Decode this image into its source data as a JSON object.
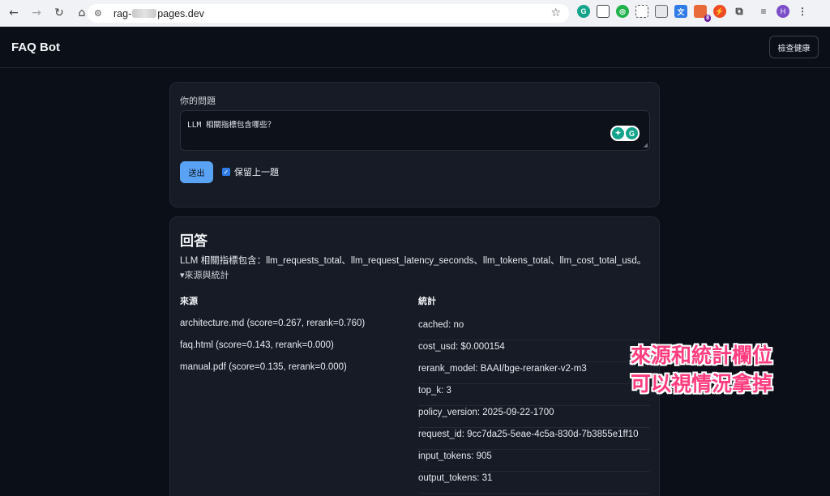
{
  "browser": {
    "url_prefix": "rag-",
    "url_suffix": "pages.dev",
    "profile_initial": "H",
    "extension_badge": "8"
  },
  "app": {
    "brand": "FAQ Bot",
    "health_button": "檢查健康"
  },
  "question": {
    "label": "你的問題",
    "value": "LLM 相關指標包含哪些？",
    "send_label": "送出",
    "keep_label": "保留上一題"
  },
  "answer": {
    "title": "回答",
    "text": "LLM 相關指標包含：llm_requests_total、llm_request_latency_seconds、llm_tokens_total、llm_cost_total_usd。",
    "summary": "▾來源與統計",
    "sources_header": "來源",
    "stats_header": "統計",
    "sources": [
      "architecture.md (score=0.267, rerank=0.760)",
      "faq.html (score=0.143, rerank=0.000)",
      "manual.pdf (score=0.135, rerank=0.000)"
    ],
    "stats": [
      "cached: no",
      "cost_usd: $0.000154",
      "rerank_model: BAAI/bge-reranker-v2-m3",
      "top_k: 3",
      "policy_version: 2025-09-22-1700",
      "request_id: 9cc7da25-5eae-4c5a-830d-7b3855e1ff10",
      "input_tokens: 905",
      "output_tokens: 31"
    ]
  },
  "annotation": {
    "line1": "來源和統計欄位",
    "line2": "可以視情況拿掉"
  }
}
